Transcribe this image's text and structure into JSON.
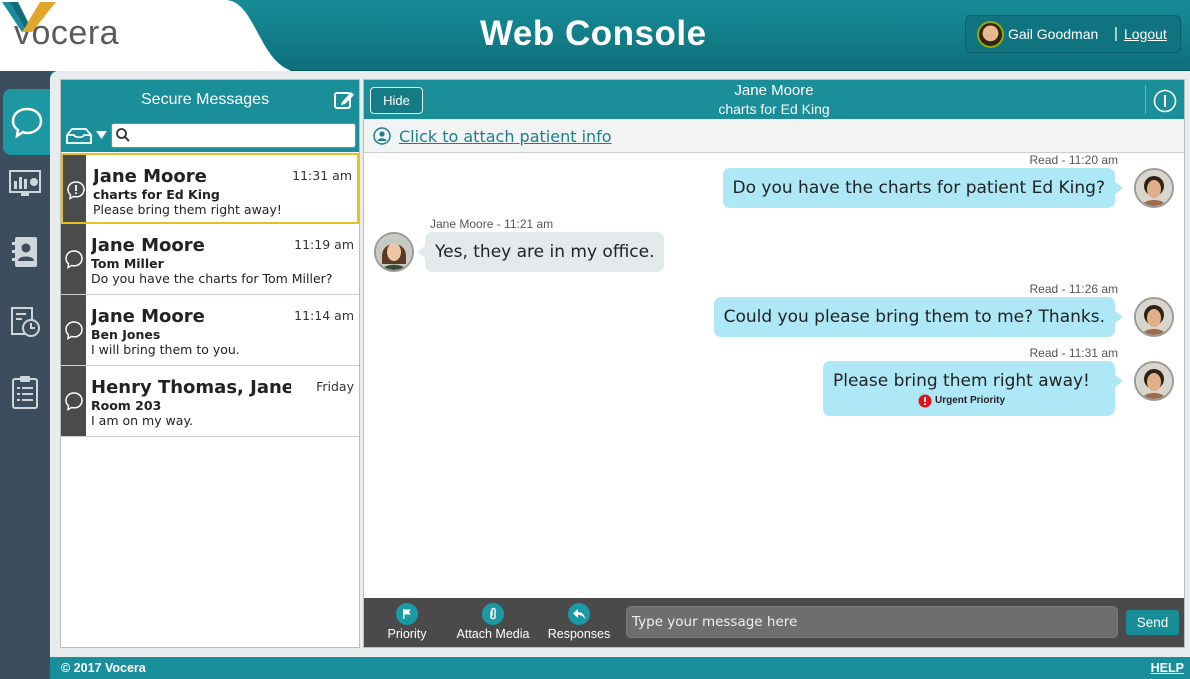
{
  "header": {
    "logo_text": "vocera",
    "app_title": "Web Console",
    "user_name": "Gail Goodman",
    "separator": "|",
    "logout_label": "Logout"
  },
  "nav": [
    {
      "icon": "chat-bubble-icon",
      "active": true
    },
    {
      "icon": "dashboard-chart-icon",
      "active": false
    },
    {
      "icon": "contacts-book-icon",
      "active": false
    },
    {
      "icon": "history-clock-icon",
      "active": false
    },
    {
      "icon": "clipboard-list-icon",
      "active": false
    }
  ],
  "list": {
    "title": "Secure Messages",
    "search_placeholder": "",
    "conversations": [
      {
        "name": "Jane Moore",
        "time": "11:31 am",
        "subject": "charts for Ed King",
        "preview": "Please bring them right away!",
        "selected": true,
        "icon": "urgent-bubble-icon"
      },
      {
        "name": "Jane Moore",
        "time": "11:19 am",
        "subject": "Tom Miller",
        "preview": "Do you have the charts for Tom Miller?",
        "selected": false,
        "icon": "chat-bubble-icon"
      },
      {
        "name": "Jane Moore",
        "time": "11:14 am",
        "subject": "Ben Jones",
        "preview": "I will bring them to you.",
        "selected": false,
        "icon": "chat-bubble-icon"
      },
      {
        "name": "Henry Thomas, Jane...",
        "time": "Friday",
        "subject": "Room 203",
        "preview": "I am on my way.",
        "selected": false,
        "icon": "chat-bubble-icon"
      }
    ]
  },
  "chat": {
    "hide_label": "Hide",
    "contact_name": "Jane Moore",
    "subject": "charts for Ed King",
    "attach_patient_label": "Click to attach patient info",
    "messages": [
      {
        "direction": "out",
        "meta": "Read - 11:20 am",
        "text": "Do you have the charts for patient Ed King?"
      },
      {
        "direction": "in",
        "meta": "Jane Moore - 11:21 am",
        "text": "Yes, they are in my office."
      },
      {
        "direction": "out",
        "meta": "Read - 11:26 am",
        "text": "Could you please bring them to me? Thanks."
      },
      {
        "direction": "out",
        "meta": "Read - 11:31 am",
        "text": "Please bring them right away!",
        "priority": "Urgent Priority"
      }
    ],
    "composer": {
      "priority_label": "Priority",
      "attach_media_label": "Attach Media",
      "responses_label": "Responses",
      "placeholder": "Type your message here",
      "send_label": "Send"
    }
  },
  "footer": {
    "copyright": "© 2017 Vocera",
    "help_label": "HELP"
  },
  "colors": {
    "teal": "#1a8e99",
    "dark_teal": "#0e6d78",
    "outgoing_bubble": "#aee8f6",
    "incoming_bubble": "#e4e9ec",
    "selected_border": "#e2c227",
    "urgent_red": "#e0141e"
  }
}
